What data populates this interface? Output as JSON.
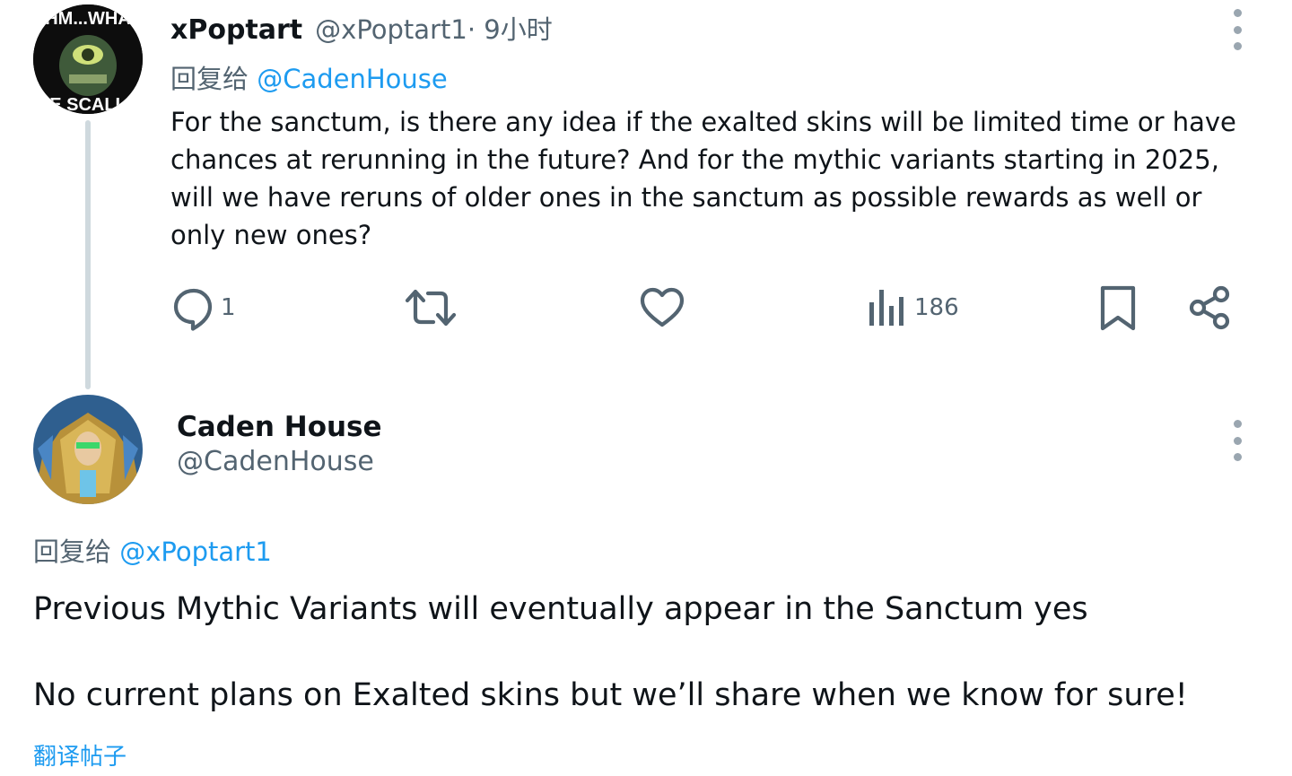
{
  "tweets": [
    {
      "author_name": "xPoptart",
      "author_handle": "@xPoptart1",
      "time": " · 9小时",
      "reply_prefix": "回复给 ",
      "reply_mention": "@CadenHouse",
      "avatar_text_top": "HM...WHA",
      "avatar_text_bottom": "E SCALL",
      "text": "For the sanctum, is there any idea if the exalted skins will be limited time or have chances at rerunning in the future? And for the mythic variants starting in 2025, will we have reruns of older ones in the sanctum as possible rewards as well or only new ones?",
      "actions": {
        "reply_count": "1",
        "retweet_count": "",
        "like_count": "",
        "views_count": "186"
      }
    },
    {
      "author_name": "Caden House",
      "author_handle": "@CadenHouse",
      "reply_prefix": "回复给 ",
      "reply_mention": "@xPoptart1",
      "text_line1": "Previous Mythic Variants will eventually appear in the Sanctum yes",
      "text_line2": "No current plans on Exalted skins but we’ll share when we know for sure!",
      "translate_label": "翻译帖子"
    }
  ],
  "icons": [
    "reply-icon",
    "retweet-icon",
    "like-icon",
    "views-icon",
    "bookmark-icon",
    "share-icon",
    "more-icon"
  ],
  "colors": {
    "accent": "#1d9bf0",
    "secondary_text": "#536471",
    "thread_line": "#cfd9de"
  }
}
